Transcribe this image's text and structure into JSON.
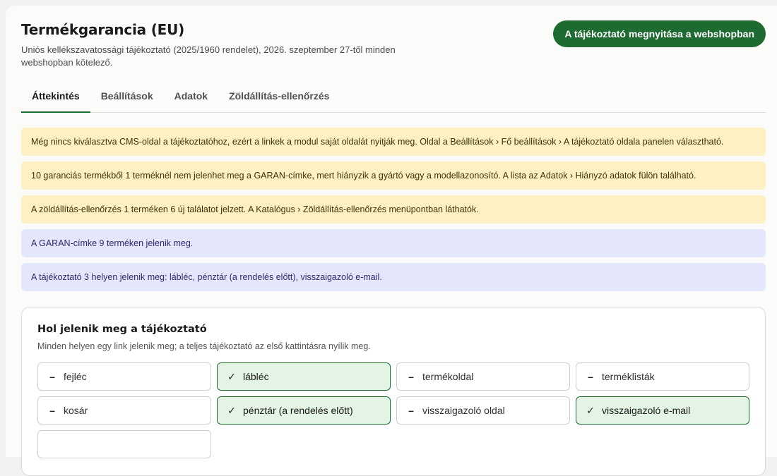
{
  "header": {
    "title": "Termékgarancia (EU)",
    "subtitle": "Uniós kellékszavatossági tájékoztató (2025/1960 rendelet), 2026. szeptember 27-től minden webshopban kötelező.",
    "open_button": "A tájékoztató megnyitása a webshopban"
  },
  "tabs": [
    {
      "label": "Áttekintés",
      "active": true
    },
    {
      "label": "Beállítások",
      "active": false
    },
    {
      "label": "Adatok",
      "active": false
    },
    {
      "label": "Zöldállítás-ellenőrzés",
      "active": false
    }
  ],
  "banners": [
    {
      "type": "warning",
      "text": "Még nincs kiválasztva CMS-oldal a tájékoztatóhoz, ezért a linkek a modul saját oldalát nyitják meg. Oldal a Beállítások › Fő beállítások › A tájékoztató oldala panelen választható."
    },
    {
      "type": "warning",
      "text": "10 garanciás termékből 1 terméknél nem jelenhet meg a GARAN-címke, mert hiányzik a gyártó vagy a modellazonosító. A lista az Adatok › Hiányzó adatok fülön található."
    },
    {
      "type": "warning",
      "text": "A zöldállítás-ellenőrzés 1 terméken 6 új találatot jelzett. A Katalógus › Zöldállítás-ellenőrzés menüpontban láthatók."
    },
    {
      "type": "info",
      "text": "A GARAN-címke 9 terméken jelenik meg."
    },
    {
      "type": "info",
      "text": "A tájékoztató 3 helyen jelenik meg: lábléc, pénztár (a rendelés előtt), visszaigazoló e-mail."
    }
  ],
  "locations": {
    "title": "Hol jelenik meg a tájékoztató",
    "subtitle": "Minden helyen egy link jelenik meg; a teljes tájékoztató az első kattintásra nyílik meg.",
    "items": [
      {
        "label": "fejléc",
        "enabled": false
      },
      {
        "label": "lábléc",
        "enabled": true
      },
      {
        "label": "termékoldal",
        "enabled": false
      },
      {
        "label": "terméklisták",
        "enabled": false
      },
      {
        "label": "kosár",
        "enabled": false
      },
      {
        "label": "pénztár (a rendelés előtt)",
        "enabled": true
      },
      {
        "label": "visszaigazoló oldal",
        "enabled": false
      },
      {
        "label": "visszaigazoló e-mail",
        "enabled": true
      },
      {
        "label": "",
        "enabled": false
      }
    ]
  },
  "icons": {
    "on": "check-icon",
    "off": "minus-icon"
  },
  "colors": {
    "accent": "#1e6b32",
    "warning_bg": "#fdf0c3",
    "info_bg": "#e4e6fc",
    "selected_bg": "#e3f3e4"
  }
}
